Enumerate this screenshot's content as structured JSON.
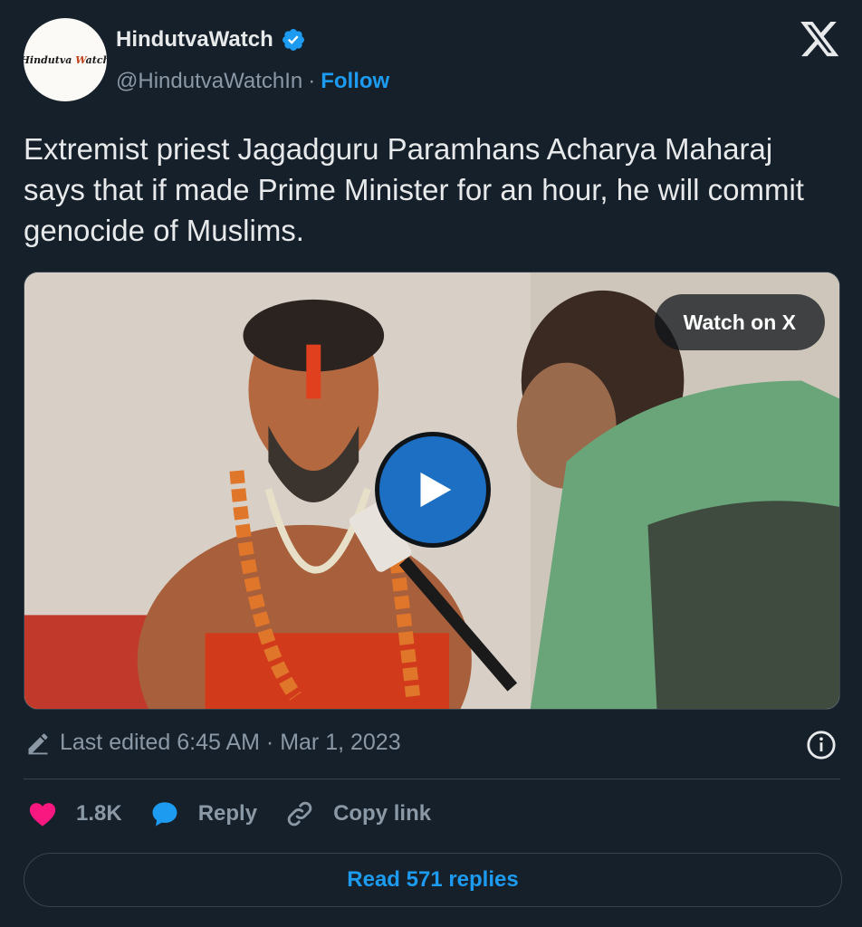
{
  "author": {
    "display_name": "HindutvaWatch",
    "handle": "@HindutvaWatchIn",
    "separator": "·",
    "follow_label": "Follow",
    "avatar_text": "Hindutva Watch",
    "verified": true
  },
  "tweet": {
    "text": "Extremist priest Jagadguru Paramhans Acharya Maharaj says that if made Prime Minister for an hour, he will commit genocide of Muslims."
  },
  "media": {
    "watch_label": "Watch on X"
  },
  "meta": {
    "edited_text": "Last edited 6:45 AM · Mar 1, 2023"
  },
  "actions": {
    "likes": "1.8K",
    "reply_label": "Reply",
    "copy_link_label": "Copy link"
  },
  "replies": {
    "label": "Read 571 replies"
  },
  "colors": {
    "background": "#15202b",
    "accent": "#1d9bf0",
    "like": "#f91880",
    "secondary_text": "#8b98a5"
  },
  "icons": [
    "verified-badge-icon",
    "x-logo-icon",
    "play-icon",
    "pencil-icon",
    "info-icon",
    "heart-icon",
    "speech-bubble-icon",
    "link-icon"
  ]
}
